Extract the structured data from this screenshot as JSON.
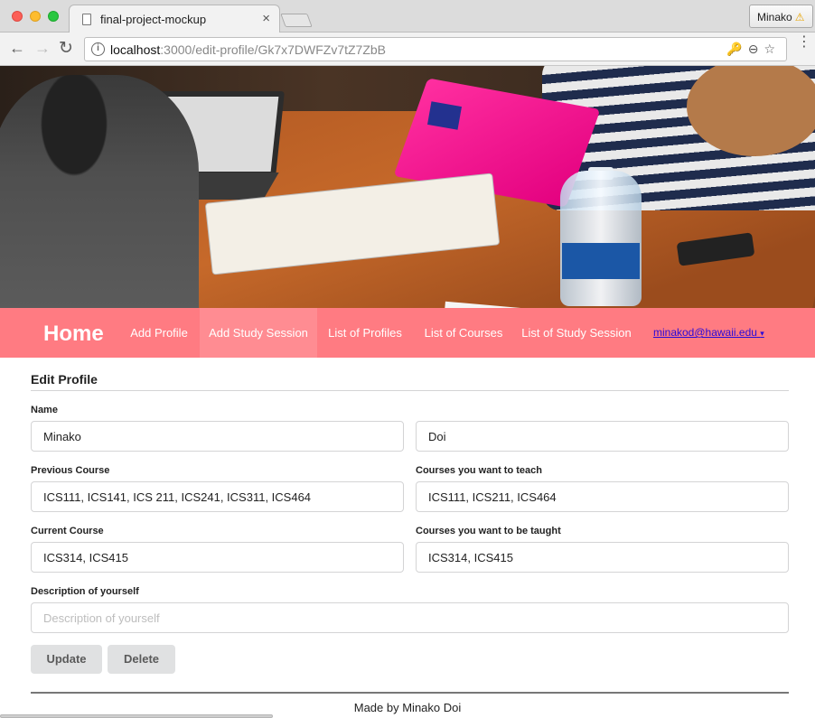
{
  "browser": {
    "tab_title": "final-project-mockup",
    "tab_close": "×",
    "profile_name": "Minako",
    "profile_warning": "⚠",
    "url_host": "localhost",
    "url_path": ":3000/edit-profile/Gk7x7DWFZv7tZ7ZbB",
    "back_glyph": "←",
    "forward_glyph": "→",
    "reload_glyph": "↻",
    "info_glyph": "i",
    "omnibox_icons": "🔑⊖☆",
    "menu_glyph": "⋮"
  },
  "navbar": {
    "brand": "Home",
    "items": [
      {
        "label": "Add Profile",
        "active": false
      },
      {
        "label": "Add Study Session",
        "active": true
      },
      {
        "label": "List of Profiles",
        "active": false
      },
      {
        "label": "List of Courses",
        "active": false
      },
      {
        "label": "List of Study Session",
        "active": false
      }
    ],
    "user_email": "minakod@hawaii.edu",
    "user_caret": "▾"
  },
  "form": {
    "heading": "Edit Profile",
    "name_label": "Name",
    "first_name": "Minako",
    "last_name": "Doi",
    "previous_course_label": "Previous Course",
    "previous_course": "ICS111, ICS141, ICS 211, ICS241, ICS311, ICS464",
    "teach_label": "Courses you want to teach",
    "teach": "ICS111, ICS211, ICS464",
    "current_course_label": "Current Course",
    "current_course": "ICS314, ICS415",
    "taught_label": "Courses you want to be taught",
    "taught": "ICS314, ICS415",
    "description_label": "Description of yourself",
    "description_placeholder": "Description of yourself",
    "update_button": "Update",
    "delete_button": "Delete"
  },
  "footer": {
    "text": "Made by Minako Doi"
  }
}
